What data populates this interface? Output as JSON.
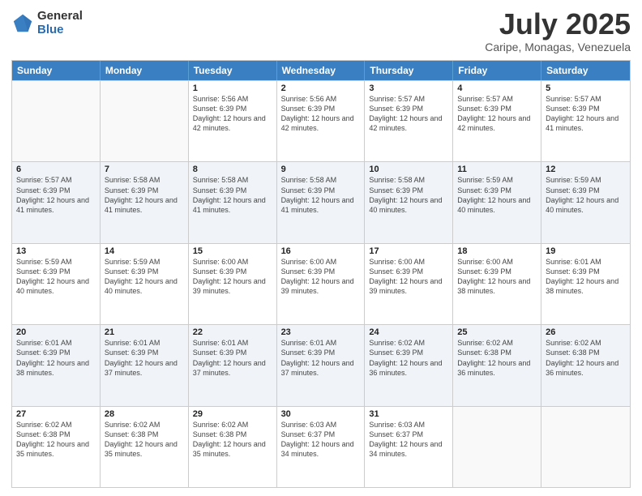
{
  "logo": {
    "general": "General",
    "blue": "Blue"
  },
  "header": {
    "month": "July 2025",
    "location": "Caripe, Monagas, Venezuela"
  },
  "weekdays": [
    "Sunday",
    "Monday",
    "Tuesday",
    "Wednesday",
    "Thursday",
    "Friday",
    "Saturday"
  ],
  "rows": [
    [
      {
        "day": "",
        "info": ""
      },
      {
        "day": "",
        "info": ""
      },
      {
        "day": "1",
        "info": "Sunrise: 5:56 AM\nSunset: 6:39 PM\nDaylight: 12 hours and 42 minutes."
      },
      {
        "day": "2",
        "info": "Sunrise: 5:56 AM\nSunset: 6:39 PM\nDaylight: 12 hours and 42 minutes."
      },
      {
        "day": "3",
        "info": "Sunrise: 5:57 AM\nSunset: 6:39 PM\nDaylight: 12 hours and 42 minutes."
      },
      {
        "day": "4",
        "info": "Sunrise: 5:57 AM\nSunset: 6:39 PM\nDaylight: 12 hours and 42 minutes."
      },
      {
        "day": "5",
        "info": "Sunrise: 5:57 AM\nSunset: 6:39 PM\nDaylight: 12 hours and 41 minutes."
      }
    ],
    [
      {
        "day": "6",
        "info": "Sunrise: 5:57 AM\nSunset: 6:39 PM\nDaylight: 12 hours and 41 minutes."
      },
      {
        "day": "7",
        "info": "Sunrise: 5:58 AM\nSunset: 6:39 PM\nDaylight: 12 hours and 41 minutes."
      },
      {
        "day": "8",
        "info": "Sunrise: 5:58 AM\nSunset: 6:39 PM\nDaylight: 12 hours and 41 minutes."
      },
      {
        "day": "9",
        "info": "Sunrise: 5:58 AM\nSunset: 6:39 PM\nDaylight: 12 hours and 41 minutes."
      },
      {
        "day": "10",
        "info": "Sunrise: 5:58 AM\nSunset: 6:39 PM\nDaylight: 12 hours and 40 minutes."
      },
      {
        "day": "11",
        "info": "Sunrise: 5:59 AM\nSunset: 6:39 PM\nDaylight: 12 hours and 40 minutes."
      },
      {
        "day": "12",
        "info": "Sunrise: 5:59 AM\nSunset: 6:39 PM\nDaylight: 12 hours and 40 minutes."
      }
    ],
    [
      {
        "day": "13",
        "info": "Sunrise: 5:59 AM\nSunset: 6:39 PM\nDaylight: 12 hours and 40 minutes."
      },
      {
        "day": "14",
        "info": "Sunrise: 5:59 AM\nSunset: 6:39 PM\nDaylight: 12 hours and 40 minutes."
      },
      {
        "day": "15",
        "info": "Sunrise: 6:00 AM\nSunset: 6:39 PM\nDaylight: 12 hours and 39 minutes."
      },
      {
        "day": "16",
        "info": "Sunrise: 6:00 AM\nSunset: 6:39 PM\nDaylight: 12 hours and 39 minutes."
      },
      {
        "day": "17",
        "info": "Sunrise: 6:00 AM\nSunset: 6:39 PM\nDaylight: 12 hours and 39 minutes."
      },
      {
        "day": "18",
        "info": "Sunrise: 6:00 AM\nSunset: 6:39 PM\nDaylight: 12 hours and 38 minutes."
      },
      {
        "day": "19",
        "info": "Sunrise: 6:01 AM\nSunset: 6:39 PM\nDaylight: 12 hours and 38 minutes."
      }
    ],
    [
      {
        "day": "20",
        "info": "Sunrise: 6:01 AM\nSunset: 6:39 PM\nDaylight: 12 hours and 38 minutes."
      },
      {
        "day": "21",
        "info": "Sunrise: 6:01 AM\nSunset: 6:39 PM\nDaylight: 12 hours and 37 minutes."
      },
      {
        "day": "22",
        "info": "Sunrise: 6:01 AM\nSunset: 6:39 PM\nDaylight: 12 hours and 37 minutes."
      },
      {
        "day": "23",
        "info": "Sunrise: 6:01 AM\nSunset: 6:39 PM\nDaylight: 12 hours and 37 minutes."
      },
      {
        "day": "24",
        "info": "Sunrise: 6:02 AM\nSunset: 6:39 PM\nDaylight: 12 hours and 36 minutes."
      },
      {
        "day": "25",
        "info": "Sunrise: 6:02 AM\nSunset: 6:38 PM\nDaylight: 12 hours and 36 minutes."
      },
      {
        "day": "26",
        "info": "Sunrise: 6:02 AM\nSunset: 6:38 PM\nDaylight: 12 hours and 36 minutes."
      }
    ],
    [
      {
        "day": "27",
        "info": "Sunrise: 6:02 AM\nSunset: 6:38 PM\nDaylight: 12 hours and 35 minutes."
      },
      {
        "day": "28",
        "info": "Sunrise: 6:02 AM\nSunset: 6:38 PM\nDaylight: 12 hours and 35 minutes."
      },
      {
        "day": "29",
        "info": "Sunrise: 6:02 AM\nSunset: 6:38 PM\nDaylight: 12 hours and 35 minutes."
      },
      {
        "day": "30",
        "info": "Sunrise: 6:03 AM\nSunset: 6:37 PM\nDaylight: 12 hours and 34 minutes."
      },
      {
        "day": "31",
        "info": "Sunrise: 6:03 AM\nSunset: 6:37 PM\nDaylight: 12 hours and 34 minutes."
      },
      {
        "day": "",
        "info": ""
      },
      {
        "day": "",
        "info": ""
      }
    ]
  ]
}
